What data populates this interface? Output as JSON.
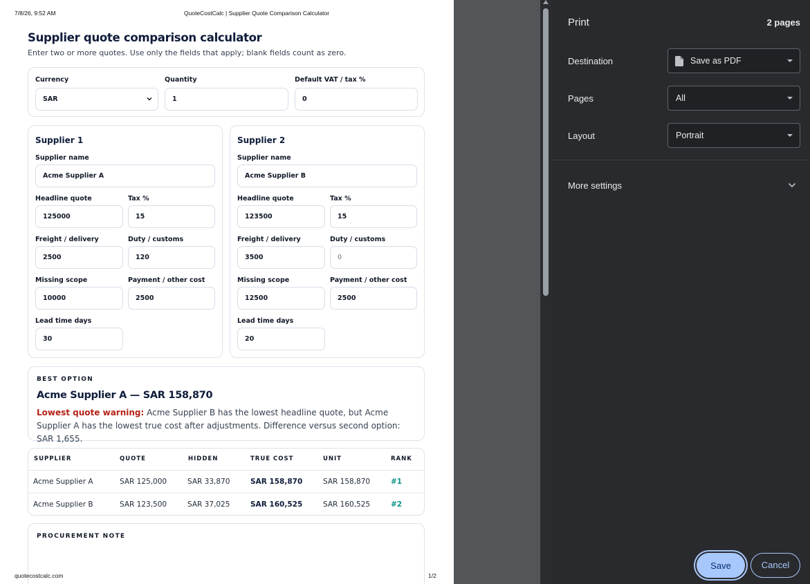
{
  "print_header": {
    "datetime": "7/8/26, 9:52 AM",
    "doc_title": "QuoteCostCalc | Supplier Quote Comparison Calculator"
  },
  "print_footer": {
    "url": "quotecostcalc.com",
    "page_num": "1/2"
  },
  "page": {
    "title": "Supplier quote comparison calculator",
    "subtitle": "Enter two or more quotes. Use only the fields that apply; blank fields count as zero."
  },
  "globals": {
    "currency_label": "Currency",
    "currency_value": "SAR",
    "quantity_label": "Quantity",
    "quantity_value": "1",
    "vat_label": "Default VAT / tax %",
    "vat_value": "0"
  },
  "suppliers": [
    {
      "title": "Supplier 1",
      "name_label": "Supplier name",
      "name": "Acme Supplier A",
      "quote_label": "Headline quote",
      "quote": "125000",
      "tax_label": "Tax %",
      "tax": "15",
      "freight_label": "Freight / delivery",
      "freight": "2500",
      "duty_label": "Duty / customs",
      "duty": "120",
      "scope_label": "Missing scope",
      "scope": "10000",
      "payment_label": "Payment / other cost",
      "payment": "2500",
      "lead_label": "Lead time days",
      "lead": "30"
    },
    {
      "title": "Supplier 2",
      "name_label": "Supplier name",
      "name": "Acme Supplier B",
      "quote_label": "Headline quote",
      "quote": "123500",
      "tax_label": "Tax %",
      "tax": "15",
      "freight_label": "Freight / delivery",
      "freight": "3500",
      "duty_label": "Duty / customs",
      "duty": "0",
      "scope_label": "Missing scope",
      "scope": "12500",
      "payment_label": "Payment / other cost",
      "payment": "2500",
      "lead_label": "Lead time days",
      "lead": "20"
    }
  ],
  "best": {
    "kicker": "BEST OPTION",
    "headline": "Acme Supplier A — SAR 158,870",
    "warning_label": "Lowest quote warning:",
    "warning_text": " Acme Supplier B has the lowest headline quote, but Acme Supplier A has the lowest true cost after adjustments. Difference versus second option: SAR 1,655."
  },
  "table": {
    "headers": [
      "SUPPLIER",
      "QUOTE",
      "HIDDEN",
      "TRUE COST",
      "UNIT",
      "RANK"
    ],
    "rows": [
      [
        "Acme Supplier A",
        "SAR 125,000",
        "SAR 33,870",
        "SAR 158,870",
        "SAR 158,870",
        "#1"
      ],
      [
        "Acme Supplier B",
        "SAR 123,500",
        "SAR 37,025",
        "SAR 160,525",
        "SAR 160,525",
        "#2"
      ]
    ]
  },
  "note": {
    "kicker": "PROCUREMENT NOTE"
  },
  "print_panel": {
    "title": "Print",
    "page_count": "2 pages",
    "destination_label": "Destination",
    "destination_value": "Save as PDF",
    "pages_label": "Pages",
    "pages_value": "All",
    "layout_label": "Layout",
    "layout_value": "Portrait",
    "more_settings": "More settings",
    "save": "Save",
    "cancel": "Cancel"
  }
}
